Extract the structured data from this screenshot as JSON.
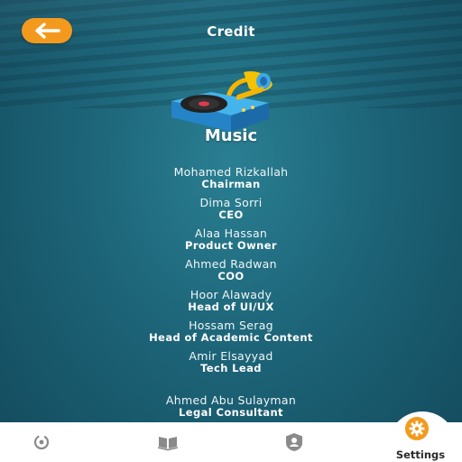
{
  "header": {
    "title": "Credit",
    "back_icon": "arrow-left-icon"
  },
  "section": {
    "title": "Music",
    "illustration": "record-player-icon"
  },
  "credits": [
    {
      "name": "Mohamed Rizkallah",
      "role": "Chairman"
    },
    {
      "name": "Dima Sorri",
      "role": "CEO"
    },
    {
      "name": "Alaa Hassan",
      "role": "Product Owner"
    },
    {
      "name": "Ahmed Radwan",
      "role": "COO"
    },
    {
      "name": "Hoor Alawady",
      "role": "Head of UI/UX"
    },
    {
      "name": "Hossam Serag",
      "role": "Head of Academic Content"
    },
    {
      "name": "Amir Elsayyad",
      "role": "Tech Lead"
    },
    {
      "name": "Ahmed Abu Sulayman",
      "role": "Legal Consultant"
    }
  ],
  "navbar": {
    "items": [
      {
        "icon": "progress-icon"
      },
      {
        "icon": "book-icon"
      },
      {
        "icon": "profile-icon"
      },
      {
        "icon": "gear-icon",
        "label": "Settings",
        "active": true
      }
    ]
  },
  "colors": {
    "accent": "#f39a1e",
    "background": "#1d6478",
    "navbar": "#ffffff",
    "inactive_icon": "#8a8a8a"
  }
}
